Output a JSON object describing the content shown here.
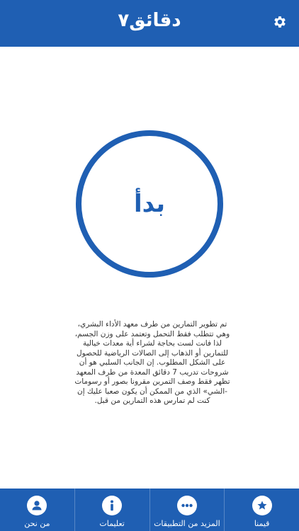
{
  "header": {
    "title": "دقائق٧"
  },
  "main": {
    "start_label": "بدأ",
    "description": "تم تطوير التمارين من طرف معهد الأداء البشري، وهي تتطلب فقط التحمل وتعتمد على وزن الجسم، لذا فانت لست بحاجة لشراء أية معدات خيالية للتمارين أو الذهاب إلى الصالات الرياضية للحصول على الشكل المطلوب. إن الجانب السلبي هو أن شروحات تدريب 7 دقائق المعدة من طرف المعهد تظهر فقط وصف التمرين مقرونا بصور أو رسومات -الشي» الذي من الممكن أن يكون صعبا عليك إن كنت لم تمارس هذه التمارين من قبل."
  },
  "tabs": [
    {
      "label": "قيمنا",
      "icon": "star-icon"
    },
    {
      "label": "المزيد من التطبيقات",
      "icon": "more-icon"
    },
    {
      "label": "تعليمات",
      "icon": "info-icon"
    },
    {
      "label": "من نحن",
      "icon": "user-icon"
    }
  ],
  "colors": {
    "primary": "#1f5fb3",
    "background": "#ffffff"
  }
}
